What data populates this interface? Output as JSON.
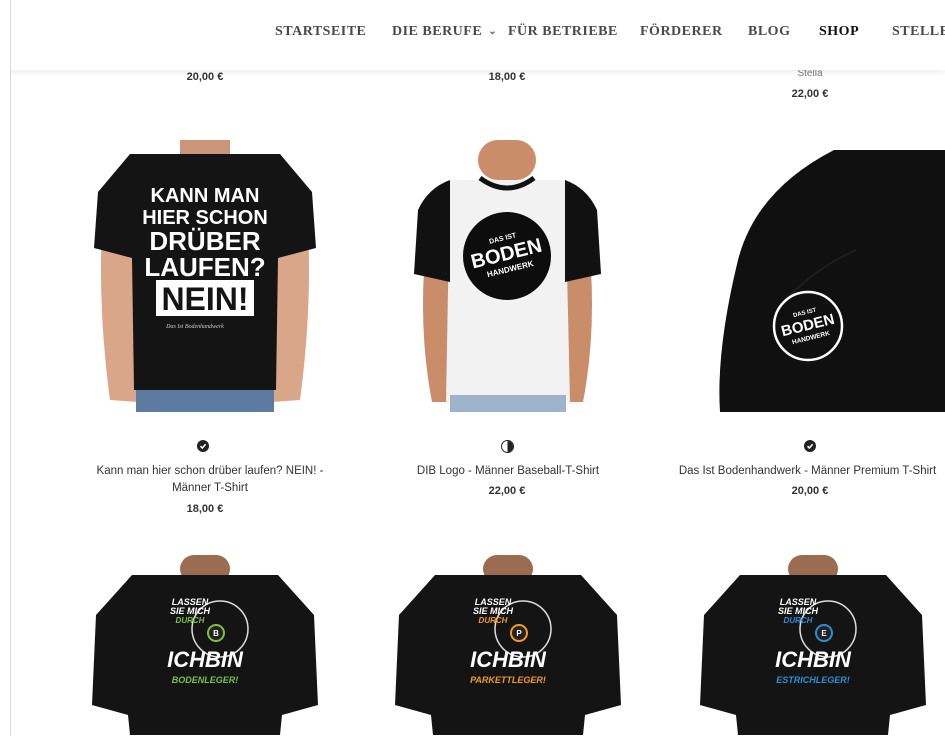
{
  "nav": {
    "items": [
      {
        "label": "STARTSEITE"
      },
      {
        "label": "DIE BERUFE"
      },
      {
        "label": "FÜR BETRIEBE"
      },
      {
        "label": "FÖRDERER"
      },
      {
        "label": "BLOG"
      },
      {
        "label": "SHOP"
      },
      {
        "label": "STELLEN"
      }
    ],
    "active": "SHOP"
  },
  "top_row": {
    "prices": [
      "20,00 €",
      "18,00 €",
      "22,00 €"
    ],
    "partial_title": "Stella"
  },
  "products": [
    {
      "title_line1": "Kann man hier schon drüber laufen? NEIN! -",
      "title_line2": "Männer T-Shirt",
      "price": "18,00 €",
      "print_lines": [
        "KANN MAN",
        "HIER SCHON",
        "DRÜBER",
        "LAUFEN?",
        "NEIN!"
      ],
      "print_small": "Das Ist Bodenhandwerk"
    },
    {
      "title_line1": "DIB Logo - Männer Baseball-T-Shirt",
      "price": "22,00 €",
      "logo_lines": [
        "DAS IST",
        "BODEN",
        "HANDWERK"
      ]
    },
    {
      "title_line1": "Das Ist Bodenhandwerk - Männer Premium T-Shirt",
      "price": "20,00 €",
      "logo_lines": [
        "DAS IST",
        "BODEN",
        "HANDWERK"
      ]
    }
  ],
  "bottom_row": [
    {
      "line1": "LASSEN",
      "line2": "SIE MICH",
      "line3": "DURCH",
      "main": "ICHBIN",
      "job": "BODENLEGER!",
      "letter": "B",
      "accent": "#7bc043"
    },
    {
      "line1": "LASSEN",
      "line2": "SIE MICH",
      "line3": "DURCH",
      "main": "ICHBIN",
      "job": "PARKETTLEGER!",
      "letter": "P",
      "accent": "#f39a1e"
    },
    {
      "line1": "LASSEN",
      "line2": "SIE MICH",
      "line3": "DURCH",
      "main": "ICHBIN",
      "job": "ESTRICHLEGER!",
      "letter": "E",
      "accent": "#2b8fd6"
    }
  ]
}
